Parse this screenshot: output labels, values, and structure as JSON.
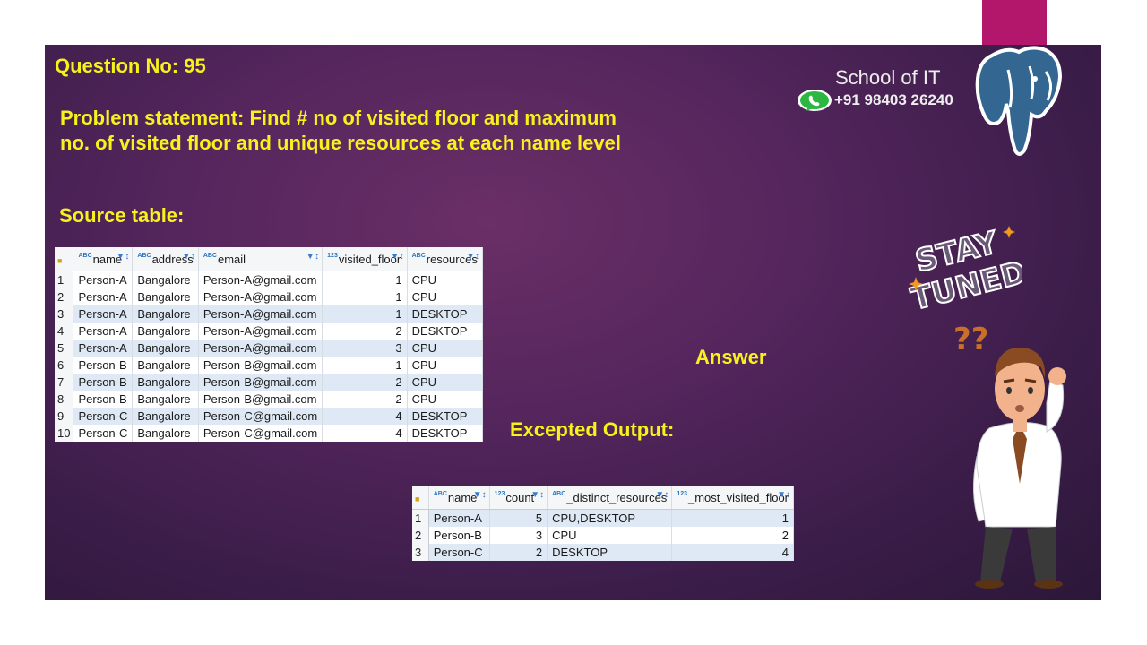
{
  "question": "Question No: 95",
  "problem_line1": "Problem statement:  Find # no of visited floor and maximum",
  "problem_line2": "no. of visited floor and unique resources at each name level",
  "source_label": "Source table:",
  "answer_label": "Answer",
  "expected_label": "Excepted Output:",
  "brand": {
    "name": "School of IT",
    "phone": "+91 98403 26240"
  },
  "colors": {
    "highlight_text": "#f7f21b",
    "background": "#55265d",
    "accent_bar": "#b3176b"
  },
  "source_table": {
    "type_tags": [
      "ABC",
      "ABC",
      "ABC",
      "123",
      "ABC"
    ],
    "columns": [
      "name",
      "address",
      "email",
      "visited_floor",
      "resources"
    ],
    "rows": [
      [
        "1",
        "Person-A",
        "Bangalore",
        "Person-A@gmail.com",
        "1",
        "CPU"
      ],
      [
        "2",
        "Person-A",
        "Bangalore",
        "Person-A@gmail.com",
        "1",
        "CPU"
      ],
      [
        "3",
        "Person-A",
        "Bangalore",
        "Person-A@gmail.com",
        "1",
        "DESKTOP"
      ],
      [
        "4",
        "Person-A",
        "Bangalore",
        "Person-A@gmail.com",
        "2",
        "DESKTOP"
      ],
      [
        "5",
        "Person-A",
        "Bangalore",
        "Person-A@gmail.com",
        "3",
        "CPU"
      ],
      [
        "6",
        "Person-B",
        "Bangalore",
        "Person-B@gmail.com",
        "1",
        "CPU"
      ],
      [
        "7",
        "Person-B",
        "Bangalore",
        "Person-B@gmail.com",
        "2",
        "CPU"
      ],
      [
        "8",
        "Person-B",
        "Bangalore",
        "Person-B@gmail.com",
        "2",
        "CPU"
      ],
      [
        "9",
        "Person-C",
        "Bangalore",
        "Person-C@gmail.com",
        "4",
        "DESKTOP"
      ],
      [
        "10",
        "Person-C",
        "Bangalore",
        "Person-C@gmail.com",
        "4",
        "DESKTOP"
      ]
    ]
  },
  "output_table": {
    "type_tags": [
      "ABC",
      "123",
      "ABC",
      "123"
    ],
    "columns": [
      "name",
      "count",
      "_distinct_resources",
      "_most_visited_floor"
    ],
    "rows": [
      [
        "1",
        "Person-A",
        "5",
        "CPU,DESKTOP",
        "1"
      ],
      [
        "2",
        "Person-B",
        "3",
        "CPU",
        "2"
      ],
      [
        "3",
        "Person-C",
        "2",
        "DESKTOP",
        "4"
      ]
    ]
  },
  "stay_tuned": {
    "line1": "STAY",
    "line2": "TUNED"
  },
  "question_marks": "??"
}
